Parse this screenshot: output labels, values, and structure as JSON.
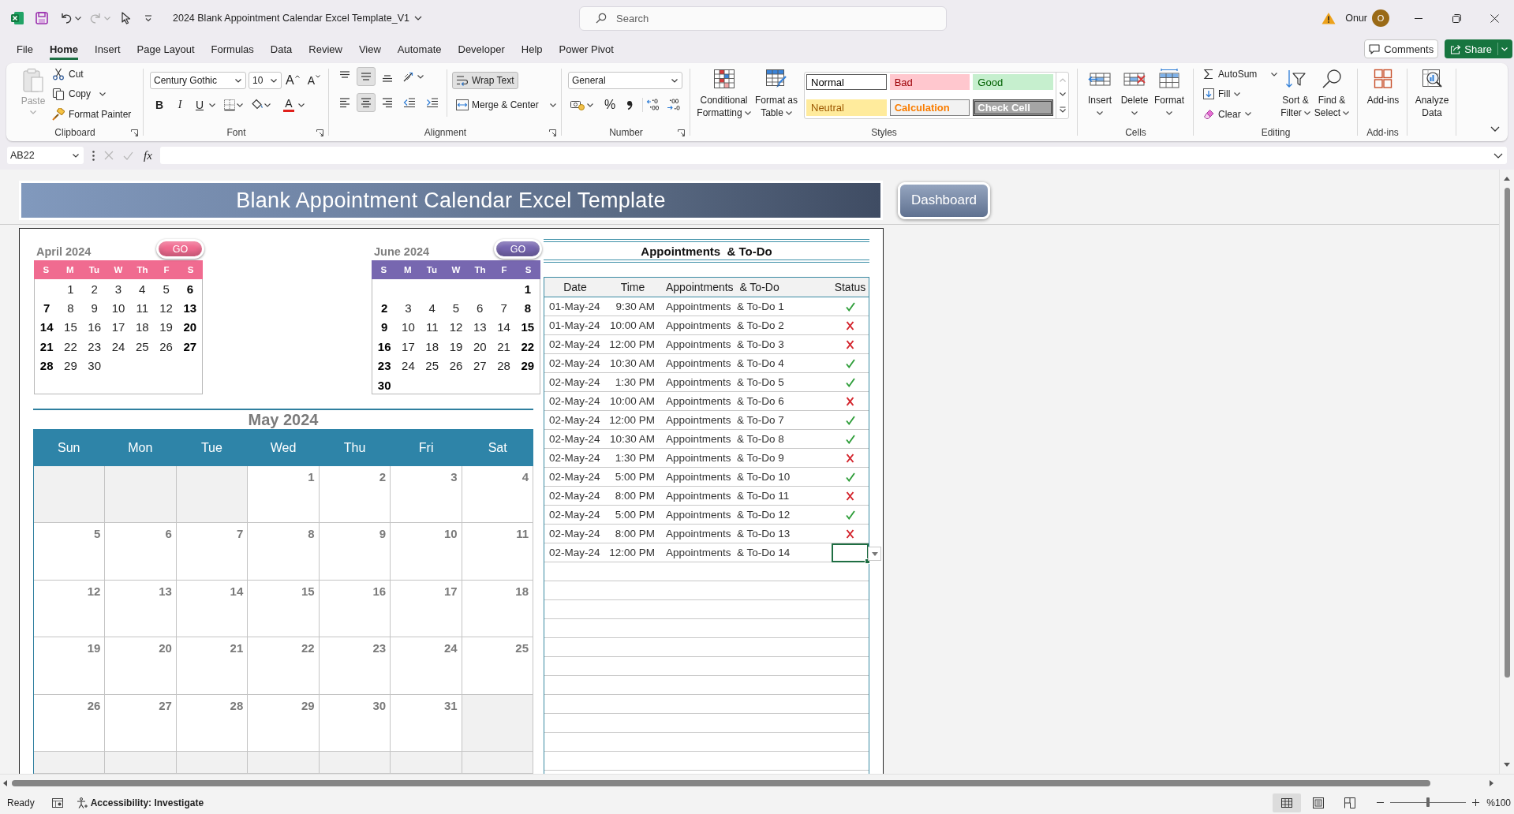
{
  "window": {
    "title": "2024 Blank Appointment Calendar Excel Template_V1",
    "quick_access": {
      "redo_disabled": true
    },
    "search": {
      "placeholder": "Search"
    },
    "user": {
      "name": "Onur",
      "initial": "O"
    }
  },
  "menu_tabs": [
    {
      "label": "File",
      "selected": false
    },
    {
      "label": "Home",
      "selected": true
    },
    {
      "label": "Insert",
      "selected": false
    },
    {
      "label": "Page Layout",
      "selected": false
    },
    {
      "label": "Formulas",
      "selected": false
    },
    {
      "label": "Data",
      "selected": false
    },
    {
      "label": "Review",
      "selected": false
    },
    {
      "label": "View",
      "selected": false
    },
    {
      "label": "Automate",
      "selected": false
    },
    {
      "label": "Developer",
      "selected": false
    },
    {
      "label": "Help",
      "selected": false
    },
    {
      "label": "Power Pivot",
      "selected": false
    }
  ],
  "header_buttons": {
    "comments": "Comments",
    "share": "Share"
  },
  "ribbon": {
    "clipboard": {
      "label": "Clipboard",
      "paste": {
        "label": "Paste",
        "disabled": true
      },
      "cut": "Cut",
      "copy": "Copy",
      "format_painter": "Format Painter"
    },
    "font": {
      "label": "Font",
      "font_name": "Century Gothic",
      "font_size": "10",
      "grow_font": "A",
      "shrink_font": "A",
      "bold": "B",
      "italic": "I",
      "underline": "U",
      "font_color": "A"
    },
    "alignment": {
      "label": "Alignment",
      "buttons": [
        {
          "kind": "top",
          "pressed": false
        },
        {
          "kind": "middle",
          "pressed": true
        },
        {
          "kind": "bottom",
          "pressed": false
        },
        {
          "kind": "left",
          "pressed": false
        },
        {
          "kind": "center",
          "pressed": true
        },
        {
          "kind": "right",
          "pressed": false
        }
      ],
      "wrap_text": {
        "label": "Wrap Text",
        "pressed": true
      },
      "merge_center": "Merge & Center"
    },
    "number": {
      "label": "Number",
      "format": "General",
      "percent": "%"
    },
    "styles": {
      "label": "Styles",
      "conditional_formatting": [
        "Conditional",
        "Formatting"
      ],
      "format_as_table": [
        "Format as",
        "Table"
      ],
      "gallery": [
        {
          "kind": "normal",
          "label": "Normal"
        },
        {
          "kind": "bad",
          "label": "Bad"
        },
        {
          "kind": "good",
          "label": "Good"
        },
        {
          "kind": "neutral",
          "label": "Neutral"
        },
        {
          "kind": "calculation",
          "label": "Calculation"
        },
        {
          "kind": "check",
          "label": "Check Cell"
        }
      ]
    },
    "cells": {
      "label": "Cells",
      "buttons": [
        {
          "kind": "insert",
          "label": "Insert"
        },
        {
          "kind": "delete",
          "label": "Delete"
        },
        {
          "kind": "format",
          "label": "Format"
        }
      ]
    },
    "editing": {
      "label": "Editing",
      "autosum": "AutoSum",
      "fill": "Fill",
      "clear": "Clear",
      "sort_filter": [
        "Sort &",
        "Filter"
      ],
      "find_select": [
        "Find &",
        "Select"
      ]
    },
    "add_ins": {
      "label": "Add-ins",
      "button": "Add-ins"
    },
    "analyze": {
      "button": [
        "Analyze",
        "Data"
      ]
    }
  },
  "formula_bar": {
    "name_box": "AB22",
    "function_label": "fx"
  },
  "sheet": {
    "banner": {
      "title": "Blank Appointment Calendar Excel Template"
    },
    "dashboard_button": "Dashboard",
    "mini_calendars": [
      {
        "title": "April 2024",
        "go_button": "GO",
        "color": "#f06b90",
        "weekday_headers": [
          "S",
          "M",
          "Tu",
          "W",
          "Th",
          "F",
          "S"
        ],
        "weeks": [
          [
            {
              "kind": "blank"
            },
            {
              "kind": "day",
              "day": "1"
            },
            {
              "kind": "day",
              "day": "2"
            },
            {
              "kind": "day",
              "day": "3"
            },
            {
              "kind": "day",
              "day": "4"
            },
            {
              "kind": "day",
              "day": "5"
            },
            {
              "kind": "day",
              "day": "6"
            }
          ],
          [
            {
              "kind": "day",
              "day": "7"
            },
            {
              "kind": "day",
              "day": "8"
            },
            {
              "kind": "day",
              "day": "9"
            },
            {
              "kind": "day",
              "day": "10"
            },
            {
              "kind": "day",
              "day": "11"
            },
            {
              "kind": "day",
              "day": "12"
            },
            {
              "kind": "day",
              "day": "13"
            }
          ],
          [
            {
              "kind": "day",
              "day": "14"
            },
            {
              "kind": "day",
              "day": "15"
            },
            {
              "kind": "day",
              "day": "16"
            },
            {
              "kind": "day",
              "day": "17"
            },
            {
              "kind": "day",
              "day": "18"
            },
            {
              "kind": "day",
              "day": "19"
            },
            {
              "kind": "day",
              "day": "20"
            }
          ],
          [
            {
              "kind": "day",
              "day": "21"
            },
            {
              "kind": "day",
              "day": "22"
            },
            {
              "kind": "day",
              "day": "23"
            },
            {
              "kind": "day",
              "day": "24"
            },
            {
              "kind": "day",
              "day": "25"
            },
            {
              "kind": "day",
              "day": "26"
            },
            {
              "kind": "day",
              "day": "27"
            }
          ],
          [
            {
              "kind": "day",
              "day": "28"
            },
            {
              "kind": "day",
              "day": "29"
            },
            {
              "kind": "day",
              "day": "30"
            },
            {
              "kind": "blank"
            },
            {
              "kind": "blank"
            },
            {
              "kind": "blank"
            },
            {
              "kind": "blank"
            }
          ]
        ]
      },
      {
        "title": "June 2024",
        "go_button": "GO",
        "color": "#7767b0",
        "weekday_headers": [
          "S",
          "M",
          "Tu",
          "W",
          "Th",
          "F",
          "S"
        ],
        "weeks": [
          [
            {
              "kind": "blank"
            },
            {
              "kind": "blank"
            },
            {
              "kind": "blank"
            },
            {
              "kind": "blank"
            },
            {
              "kind": "blank"
            },
            {
              "kind": "blank"
            },
            {
              "kind": "day",
              "day": "1"
            }
          ],
          [
            {
              "kind": "day",
              "day": "2"
            },
            {
              "kind": "day",
              "day": "3"
            },
            {
              "kind": "day",
              "day": "4"
            },
            {
              "kind": "day",
              "day": "5"
            },
            {
              "kind": "day",
              "day": "6"
            },
            {
              "kind": "day",
              "day": "7"
            },
            {
              "kind": "day",
              "day": "8"
            }
          ],
          [
            {
              "kind": "day",
              "day": "9"
            },
            {
              "kind": "day",
              "day": "10"
            },
            {
              "kind": "day",
              "day": "11"
            },
            {
              "kind": "day",
              "day": "12"
            },
            {
              "kind": "day",
              "day": "13"
            },
            {
              "kind": "day",
              "day": "14"
            },
            {
              "kind": "day",
              "day": "15"
            }
          ],
          [
            {
              "kind": "day",
              "day": "16"
            },
            {
              "kind": "day",
              "day": "17"
            },
            {
              "kind": "day",
              "day": "18"
            },
            {
              "kind": "day",
              "day": "19"
            },
            {
              "kind": "day",
              "day": "20"
            },
            {
              "kind": "day",
              "day": "21"
            },
            {
              "kind": "day",
              "day": "22"
            }
          ],
          [
            {
              "kind": "day",
              "day": "23"
            },
            {
              "kind": "day",
              "day": "24"
            },
            {
              "kind": "day",
              "day": "25"
            },
            {
              "kind": "day",
              "day": "26"
            },
            {
              "kind": "day",
              "day": "27"
            },
            {
              "kind": "day",
              "day": "28"
            },
            {
              "kind": "day",
              "day": "29"
            }
          ],
          [
            {
              "kind": "day",
              "day": "30"
            },
            {
              "kind": "blank"
            },
            {
              "kind": "blank"
            },
            {
              "kind": "blank"
            },
            {
              "kind": "blank"
            },
            {
              "kind": "blank"
            },
            {
              "kind": "blank"
            }
          ]
        ]
      }
    ],
    "month_calendar": {
      "title": "May 2024",
      "weekday_headers": [
        "Sun",
        "Mon",
        "Tue",
        "Wed",
        "Thu",
        "Fri",
        "Sat"
      ],
      "weeks": [
        [
          {
            "kind": "blank"
          },
          {
            "kind": "blank"
          },
          {
            "kind": "blank"
          },
          {
            "kind": "day",
            "day": "1"
          },
          {
            "kind": "day",
            "day": "2"
          },
          {
            "kind": "day",
            "day": "3"
          },
          {
            "kind": "day",
            "day": "4"
          }
        ],
        [
          {
            "kind": "day",
            "day": "5"
          },
          {
            "kind": "day",
            "day": "6"
          },
          {
            "kind": "day",
            "day": "7"
          },
          {
            "kind": "day",
            "day": "8"
          },
          {
            "kind": "day",
            "day": "9"
          },
          {
            "kind": "day",
            "day": "10"
          },
          {
            "kind": "day",
            "day": "11"
          }
        ],
        [
          {
            "kind": "day",
            "day": "12"
          },
          {
            "kind": "day",
            "day": "13"
          },
          {
            "kind": "day",
            "day": "14"
          },
          {
            "kind": "day",
            "day": "15"
          },
          {
            "kind": "day",
            "day": "16"
          },
          {
            "kind": "day",
            "day": "17"
          },
          {
            "kind": "day",
            "day": "18"
          }
        ],
        [
          {
            "kind": "day",
            "day": "19"
          },
          {
            "kind": "day",
            "day": "20"
          },
          {
            "kind": "day",
            "day": "21"
          },
          {
            "kind": "day",
            "day": "22"
          },
          {
            "kind": "day",
            "day": "23"
          },
          {
            "kind": "day",
            "day": "24"
          },
          {
            "kind": "day",
            "day": "25"
          }
        ],
        [
          {
            "kind": "day",
            "day": "26"
          },
          {
            "kind": "day",
            "day": "27"
          },
          {
            "kind": "day",
            "day": "28"
          },
          {
            "kind": "day",
            "day": "29"
          },
          {
            "kind": "day",
            "day": "30"
          },
          {
            "kind": "day",
            "day": "31"
          },
          {
            "kind": "blank"
          }
        ],
        [
          {
            "kind": "blank"
          },
          {
            "kind": "blank"
          },
          {
            "kind": "blank"
          },
          {
            "kind": "blank"
          },
          {
            "kind": "blank"
          },
          {
            "kind": "blank"
          },
          {
            "kind": "blank"
          }
        ]
      ]
    },
    "appointments": {
      "title": "Appointments  & To-Do",
      "columns": [
        "Date",
        "Time",
        "Appointments  & To-Do",
        "Status"
      ],
      "rows": [
        {
          "date": "01-May-24",
          "time": "9:30 AM",
          "task": "Appointments  & To-Do 1",
          "done": true,
          "status_selected": false
        },
        {
          "date": "01-May-24",
          "time": "10:00 AM",
          "task": "Appointments  & To-Do 2",
          "done": false,
          "status_selected": false
        },
        {
          "date": "02-May-24",
          "time": "12:00 PM",
          "task": "Appointments  & To-Do 3",
          "done": false,
          "status_selected": false
        },
        {
          "date": "02-May-24",
          "time": "10:30 AM",
          "task": "Appointments  & To-Do 4",
          "done": true,
          "status_selected": false
        },
        {
          "date": "02-May-24",
          "time": "1:30 PM",
          "task": "Appointments  & To-Do 5",
          "done": true,
          "status_selected": false
        },
        {
          "date": "02-May-24",
          "time": "10:00 AM",
          "task": "Appointments  & To-Do 6",
          "done": false,
          "status_selected": false
        },
        {
          "date": "02-May-24",
          "time": "12:00 PM",
          "task": "Appointments  & To-Do 7",
          "done": true,
          "status_selected": false
        },
        {
          "date": "02-May-24",
          "time": "10:30 AM",
          "task": "Appointments  & To-Do 8",
          "done": true,
          "status_selected": false
        },
        {
          "date": "02-May-24",
          "time": "1:30 PM",
          "task": "Appointments  & To-Do 9",
          "done": false,
          "status_selected": false
        },
        {
          "date": "02-May-24",
          "time": "5:00 PM",
          "task": "Appointments  & To-Do 10",
          "done": true,
          "status_selected": false
        },
        {
          "date": "02-May-24",
          "time": "8:00 PM",
          "task": "Appointments  & To-Do 11",
          "done": false,
          "status_selected": false
        },
        {
          "date": "02-May-24",
          "time": "5:00 PM",
          "task": "Appointments  & To-Do 12",
          "done": true,
          "status_selected": false
        },
        {
          "date": "02-May-24",
          "time": "8:00 PM",
          "task": "Appointments  & To-Do 13",
          "done": false,
          "status_selected": false
        },
        {
          "date": "02-May-24",
          "time": "12:00 PM",
          "task": "Appointments  & To-Do 14",
          "status_selected": true
        }
      ]
    }
  },
  "status_bar": {
    "ready": "Ready",
    "accessibility": "Accessibility: Investigate",
    "views": [
      {
        "kind": "normal",
        "selected": true
      },
      {
        "kind": "page_layout",
        "selected": false
      },
      {
        "kind": "page_break",
        "selected": false
      }
    ],
    "zoom": {
      "level": 0.5,
      "reading": "%100"
    }
  }
}
